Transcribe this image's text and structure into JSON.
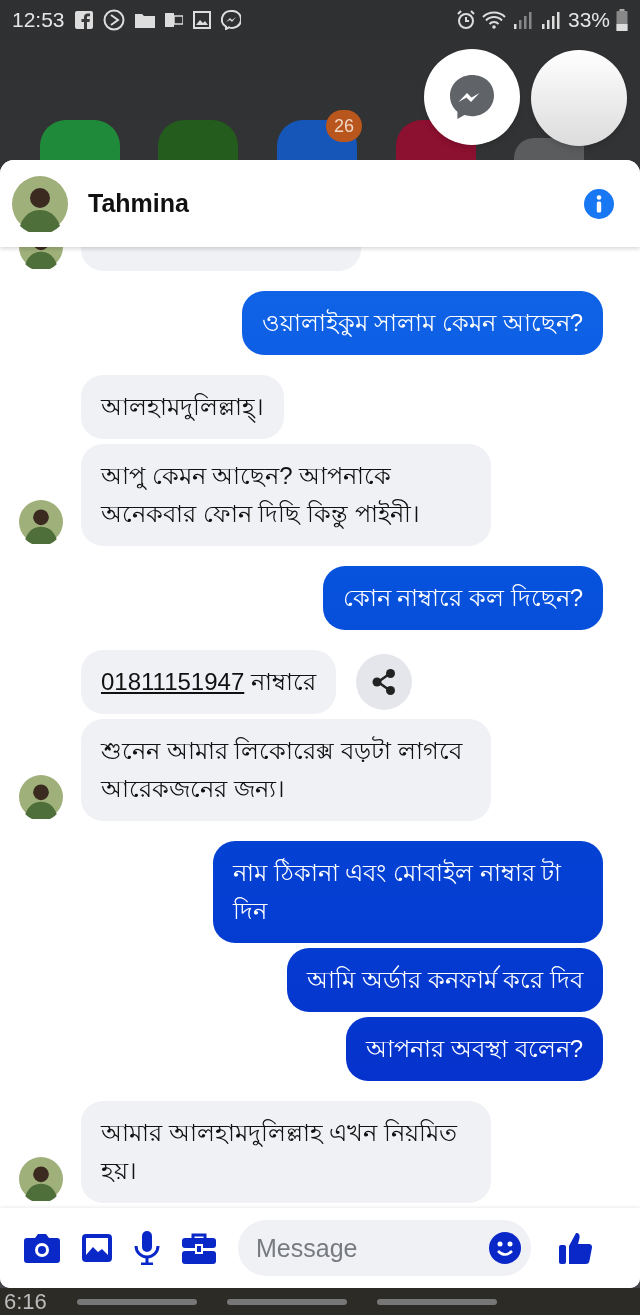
{
  "status_bar": {
    "time": "12:53",
    "battery": "33%"
  },
  "home_screen": {
    "badge": "26",
    "bottom_time": "6:16"
  },
  "chat": {
    "contact": "Tahmina",
    "messages": [
      {
        "kind": "partial"
      },
      {
        "kind": "sent",
        "text": "ওয়ালাইকুম সালাম কেমন আছেন?"
      },
      {
        "kind": "received",
        "text": "আলহামদুলিল্লাহ্।"
      },
      {
        "kind": "received",
        "text": "আপু কেমন আছেন? আপনাকে অনেকবার ফোন দিছি কিন্তু পাইনী।"
      },
      {
        "kind": "sent",
        "text": "কোন নাম্বারে কল দিছেন?"
      },
      {
        "kind": "received",
        "link": "01811151947",
        "text": "নাম্বারে",
        "share": true
      },
      {
        "kind": "received",
        "text": "শুনেন আমার লিকোরেক্স বড়টা লাগবে আরেকজনের জন্য।"
      },
      {
        "kind": "sent",
        "text": "নাম ঠিকানা এবং মোবাইল নাম্বার টা দিন"
      },
      {
        "kind": "sent",
        "text": "আমি অর্ডার কনফার্ম করে দিব"
      },
      {
        "kind": "sent",
        "text": "আপনার অবস্থা বলেন?"
      },
      {
        "kind": "received",
        "text": "আমার আলহামদুলিল্লাহ এখন নিয়মিত হয়।"
      }
    ],
    "composer": {
      "placeholder": "Message"
    }
  }
}
